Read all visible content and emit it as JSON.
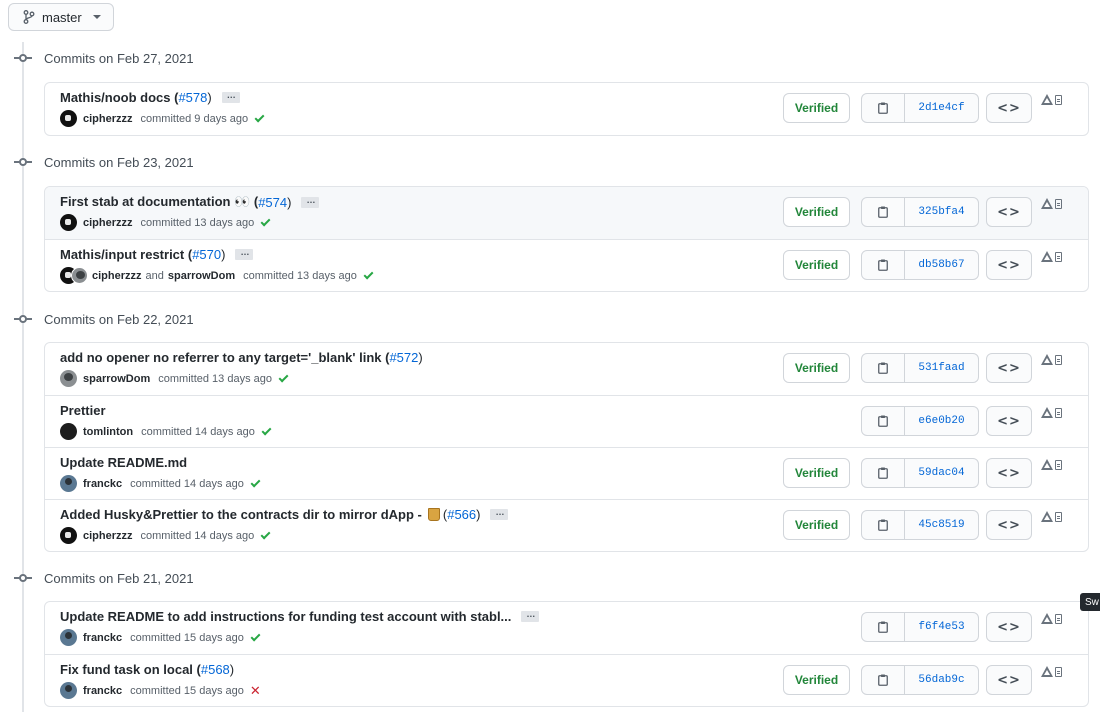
{
  "branch": {
    "label": "master"
  },
  "icons": {
    "branch": "git-branch-icon",
    "caret": "caret-down-icon",
    "copy": "clipboard-icon",
    "browse": "code-icon",
    "extensions": "warning-icon"
  },
  "colors": {
    "verified": "#22863a",
    "link": "#0366d6",
    "check": "#28a745",
    "fail": "#cb2431"
  },
  "tooltip": "Sw",
  "groups": [
    {
      "title": "Commits on Feb 27, 2021",
      "commits": [
        {
          "title": "Mathis/noob docs (",
          "pr": "#578",
          "pr_close": ")",
          "ellipsis": "…",
          "authors": [
            "cipherzzz"
          ],
          "joiner": "",
          "time": "committed 9 days ago",
          "status": "success",
          "verified": "Verified",
          "sha": "2d1e4cf"
        }
      ]
    },
    {
      "title": "Commits on Feb 23, 2021",
      "commits": [
        {
          "title": "First stab at documentation 👀 (",
          "pr": "#574",
          "pr_close": ")",
          "ellipsis": "…",
          "authors": [
            "cipherzzz"
          ],
          "joiner": "",
          "time": "committed 13 days ago",
          "status": "success",
          "verified": "Verified",
          "sha": "325bfa4"
        },
        {
          "title": "Mathis/input restrict (",
          "pr": "#570",
          "pr_close": ")",
          "ellipsis": "…",
          "authors": [
            "cipherzzz",
            "sparrowDom"
          ],
          "joiner": "and",
          "time": "committed 13 days ago",
          "status": "success",
          "verified": "Verified",
          "sha": "db58b67"
        }
      ]
    },
    {
      "title": "Commits on Feb 22, 2021",
      "commits": [
        {
          "title": "add no opener no referrer to any target='_blank' link (",
          "pr": "#572",
          "pr_close": ")",
          "ellipsis": "",
          "authors": [
            "sparrowDom"
          ],
          "joiner": "",
          "time": "committed 13 days ago",
          "status": "success",
          "verified": "Verified",
          "sha": "531faad"
        },
        {
          "title": "Prettier",
          "pr": "",
          "pr_close": "",
          "ellipsis": "",
          "authors": [
            "tomlinton"
          ],
          "joiner": "",
          "time": "committed 14 days ago",
          "status": "success",
          "verified": "",
          "sha": "e6e0b20"
        },
        {
          "title": "Update README.md",
          "pr": "",
          "pr_close": "",
          "ellipsis": "",
          "authors": [
            "franckc"
          ],
          "joiner": "",
          "time": "committed 14 days ago",
          "status": "success",
          "verified": "Verified",
          "sha": "59dac04"
        },
        {
          "title": "Added Husky&Prettier to the contracts dir to mirror dApp - ",
          "emoji": "beer-mug",
          "pr": "#566",
          "pr_open": "(",
          "pr_close": ")",
          "ellipsis": "…",
          "authors": [
            "cipherzzz"
          ],
          "joiner": "",
          "time": "committed 14 days ago",
          "status": "success",
          "verified": "Verified",
          "sha": "45c8519"
        }
      ]
    },
    {
      "title": "Commits on Feb 21, 2021",
      "commits": [
        {
          "title": "Update README to add instructions for funding test account with stabl...",
          "pr": "",
          "pr_close": "",
          "ellipsis": "…",
          "authors": [
            "franckc"
          ],
          "joiner": "",
          "time": "committed 15 days ago",
          "status": "success",
          "verified": "",
          "sha": "f6f4e53"
        },
        {
          "title": "Fix fund task on local (",
          "pr": "#568",
          "pr_close": ")",
          "ellipsis": "",
          "authors": [
            "franckc"
          ],
          "joiner": "",
          "time": "committed 15 days ago",
          "status": "failure",
          "verified": "Verified",
          "sha": "56dab9c"
        }
      ]
    }
  ]
}
